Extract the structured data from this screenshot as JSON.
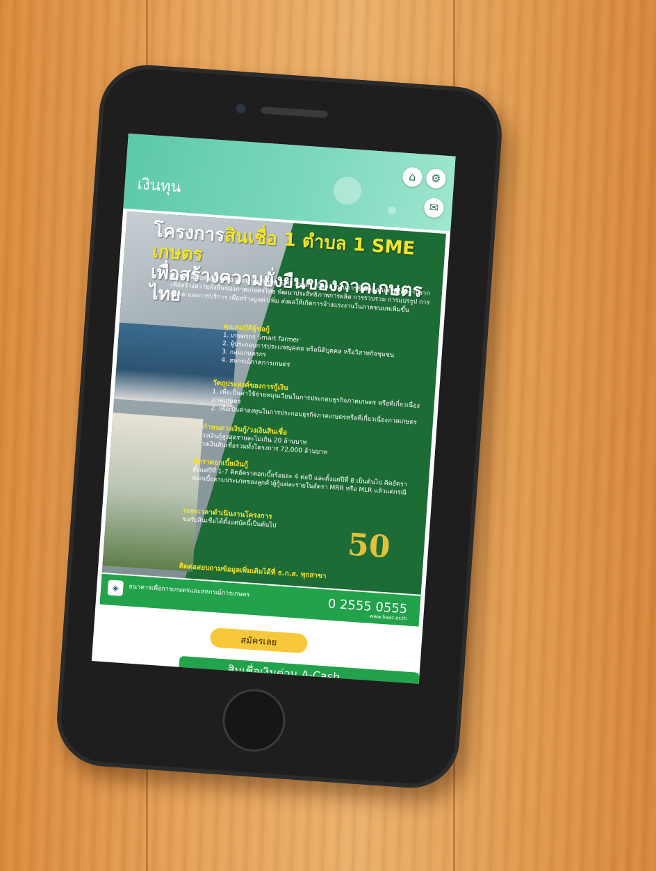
{
  "app": {
    "header_title": "เงินทุน",
    "home_icon": "home-icon",
    "settings_icon": "gear-icon",
    "chat_icon": "chat-icon"
  },
  "poster": {
    "title_line1_a": "โครงการ",
    "title_line1_b": "สินเชื่อ 1 ตำบล 1 SME เกษตร",
    "title_line2": "เพื่อสร้างความยั่งยืนของภาคเกษตรไทย",
    "intro": "ธ.ก.ส. สนับสนุนสินเชื่อ เพื่อยกระดับเป็น SME เกษตร เป็นกลไกในการขับเคลื่อนเศรษฐกิจฐานราก เพื่อสร้างความยั่งยืนของภาคเกษตรไทย พัฒนาประสิทธิภาพการผลิต การรวบรวม การแปรรูป การตลาด และการบริการ เพื่อสร้างมูลค่าเพิ่ม ส่งผลให้เกิดการจ้างแรงงานในภาคชนบทเพิ่มขึ้น",
    "qual_head": "คุณสมบัติผู้ขอกู้",
    "qual_1": "1. เกษตรกร Smart farmer",
    "qual_2": "2. ผู้ประกอบการประเภทบุคคล หรือนิติบุคคล หรือวิสาหกิจชุมชน",
    "qual_3": "3. กลุ่มเกษตรกร",
    "qual_4": "4. สหกรณ์ภาคการเกษตร",
    "obj_head": "วัตถุประสงค์ของการกู้เงิน",
    "obj_1": "1. เพื่อเป็นค่าใช้จ่ายหมุนเวียนในการประกอบธุรกิจภาคเกษตร หรือที่เกี่ยวเนื่องภาคเกษตร",
    "obj_2": "2. เพื่อเป็นค่าลงทุนในการประกอบธุรกิจภาคเกษตรหรือที่เกี่ยวเนื่องภาคเกษตร",
    "limit_head": "กำหนดวงเงินกู้/วงเงินสินเชื่อ",
    "limit_1": "วงเงินกู้สูงสุดรายละไม่เกิน 20 ล้านบาท",
    "limit_2": "วงเงินสินเชื่อรวมทั้งโครงการ 72,000 ล้านบาท",
    "rate_head": "อัตราดอกเบี้ยเงินกู้",
    "rate_text": "ตั้งแต่ปีที่ 1-7 คิดอัตราดอกเบี้ยร้อยละ 4 ต่อปี และตั้งแต่ปีที่ 8 เป็นต้นไป คิดอัตราดอกเบี้ยตามประเภทของลูกค้าผู้กู้แต่ละรายในอัตรา MRR หรือ MLR แล้วแต่กรณี",
    "period_head": "ระยะเวลาดำเนินงานโครงการ",
    "period_text": "ขอรับสินเชื่อได้ตั้งแต่บัดนี้เป็นต้นไป",
    "contact": "ติดต่อสอบถามข้อมูลเพิ่มเติมได้ที่ ธ.ก.ส. ทุกสาขา",
    "anniv": "50"
  },
  "bank": {
    "name": "ธนาคารเพื่อการเกษตรและสหกรณ์การเกษตร",
    "phone": "0 2555 0555",
    "url": "www.baac.or.th"
  },
  "actions": {
    "apply_label": "สมัครเลย",
    "next_card": "สินเชื่อเงินด่วน A-Cash"
  }
}
